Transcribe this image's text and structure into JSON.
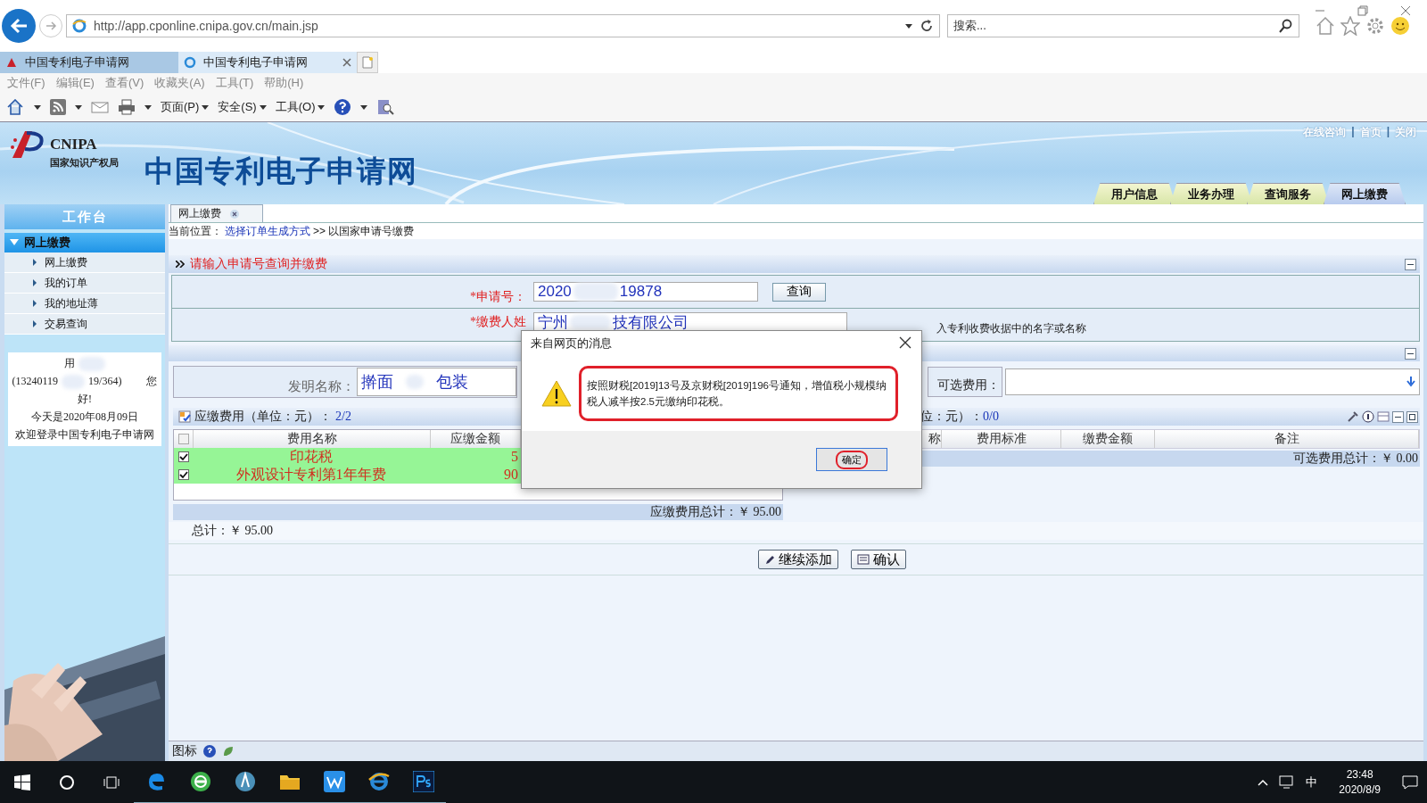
{
  "browser": {
    "address": "http://app.cponline.cnipa.gov.cn/main.jsp",
    "search_placeholder": "搜索...",
    "tabs": [
      {
        "label": "中国专利电子申请网",
        "selected": false
      },
      {
        "label": "中国专利电子申请网",
        "selected": true
      }
    ],
    "menu": [
      "文件(F)",
      "编辑(E)",
      "查看(V)",
      "收藏夹(A)",
      "工具(T)",
      "帮助(H)"
    ],
    "commands": [
      "页面(P)",
      "安全(S)",
      "工具(O)"
    ]
  },
  "site": {
    "logo": "CNIPA",
    "logo_sub": "国家知识产权局",
    "title": "中国专利电子申请网",
    "top_links": [
      "在线咨询",
      "首页",
      "关闭"
    ],
    "link_separator": "|",
    "nav": [
      {
        "label": "用户信息",
        "selected": false
      },
      {
        "label": "业务办理",
        "selected": false
      },
      {
        "label": "查询服务",
        "selected": false
      },
      {
        "label": "网上缴费",
        "selected": true
      }
    ]
  },
  "sidebar": {
    "title": "工作台",
    "group": {
      "label": "网上缴费",
      "expanded": true
    },
    "items": [
      "网上缴费",
      "我的订单",
      "我的地址薄",
      "交易查询"
    ],
    "user": {
      "name_part": "用",
      "id_parts": [
        "(13240119",
        "19/364)"
      ],
      "greeting": [
        "您",
        "好!"
      ],
      "date": "今天是2020年08月09日",
      "welcome": "欢迎登录中国专利电子申请网"
    }
  },
  "main": {
    "tab": "网上缴费",
    "breadcrumb": {
      "label": "当前位置：",
      "link": "选择订单生成方式",
      "sep": ">>",
      "current": "以国家申请号缴费"
    },
    "query": {
      "title": "请输入申请号查询并缴费",
      "number_label": "*申请号：",
      "number_parts": [
        "2020",
        "19878"
      ],
      "query_button": "查询",
      "payer_label": "*缴费人姓",
      "payer_parts": [
        "宁州",
        "技有限公司"
      ],
      "payer_hint": "入专利收费收据中的名字或名称"
    },
    "invention": {
      "label": "发明名称：",
      "parts": [
        "擀面",
        "包装"
      ]
    },
    "optional_label": "可选费用：",
    "fees": {
      "title": "应缴费用（单位：元）：",
      "count": "2/2",
      "all_checked": false,
      "columns": [
        "费用名称",
        "应缴金额"
      ],
      "rows": [
        {
          "name": "印花税",
          "amount": "5",
          "checked": true
        },
        {
          "name": "外观设计专利第1年年费",
          "amount": "90",
          "checked": true
        }
      ],
      "total": "应缴费用总计：￥ 95.00"
    },
    "optional": {
      "title": "位：元）：",
      "count": "0/0",
      "columns": [
        "称",
        "费用标准",
        "缴费金额",
        "备注"
      ],
      "total": "可选费用总计：￥ 0.00"
    },
    "grand_total": "总计：￥ 95.00",
    "buttons": [
      "继续添加",
      "确认"
    ],
    "status": "图标"
  },
  "dialog": {
    "title": "来自网页的消息",
    "message": "按照财税[2019]13号及京财税[2019]196号通知，增值税小规模纳税人减半按2.5元缴纳印花税。",
    "button": "确定"
  },
  "taskbar": {
    "ime": "中",
    "time": "23:48",
    "date": "2020/8/9"
  }
}
